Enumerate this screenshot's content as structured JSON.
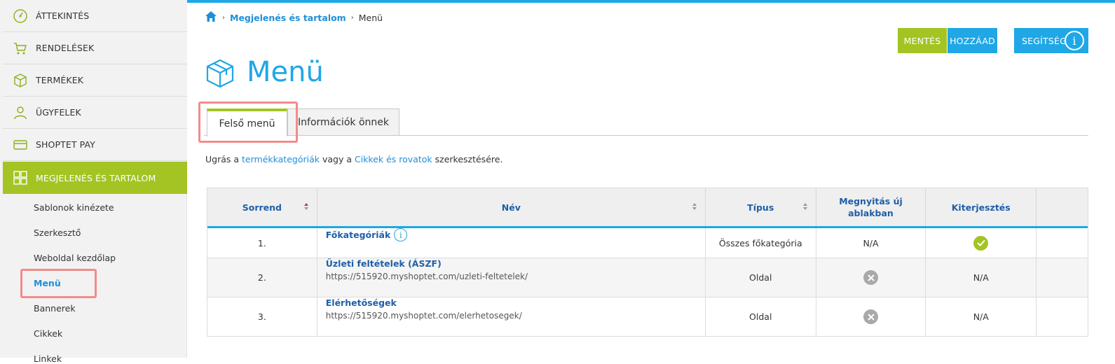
{
  "sidebar": {
    "items": [
      {
        "label": "ÁTTEKINTÉS",
        "icon": "dashboard-gauge-icon"
      },
      {
        "label": "RENDELÉSEK",
        "icon": "cart-icon"
      },
      {
        "label": "TERMÉKEK",
        "icon": "box-icon"
      },
      {
        "label": "ÜGYFELEK",
        "icon": "user-icon"
      },
      {
        "label": "SHOPTET PAY",
        "icon": "card-icon"
      },
      {
        "label": "MEGJELENÉS ÉS TARTALOM",
        "icon": "layout-grid-icon"
      }
    ],
    "subitems": [
      "Sablonok kinézete",
      "Szerkesztő",
      "Weboldal kezdőlap",
      "Menü",
      "Bannerek",
      "Cikkek",
      "Linkek"
    ]
  },
  "breadcrumb": {
    "home_icon": "home-icon",
    "section": "Megjelenés és tartalom",
    "current": "Menü"
  },
  "toolbar": {
    "save_label": "MENTÉS",
    "add_label": "HOZZÁAD",
    "help_label": "SEGÍTSÉG",
    "help_icon_glyph": "i"
  },
  "page": {
    "title": "Menü",
    "title_icon": "box-icon"
  },
  "tabs": [
    {
      "label": "Felső menü"
    },
    {
      "label": "Információk önnek"
    }
  ],
  "info_line": {
    "prefix": "Ugrás a ",
    "link1": "termékkategóriák",
    "middle": " vagy a ",
    "link2": "Cikkek és rovatok",
    "suffix": " szerkesztésére."
  },
  "table": {
    "headers": [
      "Sorrend",
      "Név",
      "Típus",
      "Megnyitás új ablakban",
      "Kiterjesztés",
      ""
    ],
    "rows": [
      {
        "order": "1.",
        "name": "Főkategóriák",
        "url": "",
        "type": "Összes főkategória",
        "new_window": "N/A",
        "extension": "check"
      },
      {
        "order": "2.",
        "name": "Üzleti feltételek (ÁSZF)",
        "url": "https://515920.myshoptet.com/uzleti-feltetelek/",
        "type": "Oldal",
        "new_window": "x",
        "extension": "N/A"
      },
      {
        "order": "3.",
        "name": "Elérhetőségek",
        "url": "https://515920.myshoptet.com/elerhetosegek/",
        "type": "Oldal",
        "new_window": "x",
        "extension": "N/A"
      }
    ]
  },
  "colors": {
    "accent_green": "#a3c423",
    "accent_blue": "#1fa7e6",
    "highlight_red": "#f28b8b"
  }
}
